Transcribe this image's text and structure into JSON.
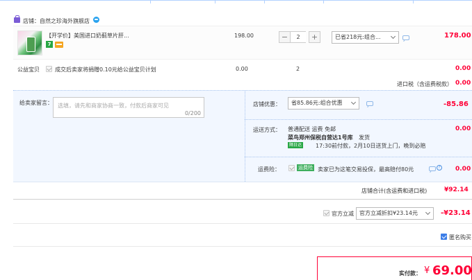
{
  "shop": {
    "label": "店铺：自然之珍海外旗舰店",
    "brand_color": "#7b5cd6",
    "chat_icon": "chat-bubble-icon"
  },
  "item": {
    "title": "【开学价】美国进口奶蓟草片肝...",
    "unit_price": "198.00",
    "quantity": "2",
    "promo_select": "已省218元:组合...",
    "subtotal": "178.00",
    "minus": "−",
    "plus": "+",
    "badge": "7"
  },
  "charity": {
    "label": "公益宝贝",
    "text": "成交后卖家将捐赠0.10元给公益宝贝计划",
    "price": "0.00",
    "qty": "2",
    "amount": "0.00"
  },
  "import_tax": {
    "label": "进口税（含运费税款）",
    "amount": "0.00"
  },
  "message": {
    "label": "给卖家留言：",
    "placeholder": "选填，请先和商家协商一致，付款后商家可见",
    "counter": "0/200"
  },
  "shop_discount": {
    "label": "店铺优惠：",
    "select": "省85.86元:组合优惠",
    "amount": "-85.86"
  },
  "shipping": {
    "label": "运送方式：",
    "method": "普通配送 运费 免邮",
    "warehouse": "菜鸟郑州保税自营达1号库",
    "ship_text": "发货",
    "tag": "隔日达",
    "eta": "17:30前付款，2月10日送货上门，晚到必赔",
    "amount": "0.00"
  },
  "insurance": {
    "label": "运费险：",
    "tag": "运费险",
    "text": "卖家已为这笔交易投保，最高赔付80元",
    "amount": "0.00"
  },
  "shop_total": {
    "label": "店铺合计(含运费和进口税)",
    "amount": "¥92.14"
  },
  "official_discount": {
    "label": "官方立减",
    "select": "官方立减折扣¥23.14元",
    "amount": "-¥23.14"
  },
  "anonymous": {
    "label": "匿名购买"
  },
  "payment": {
    "label": "实付款：",
    "currency": "¥",
    "amount": "69.00"
  },
  "colors": {
    "price_red": "#ff0036",
    "panel_bg": "#f2f7ff",
    "accent_blue": "#3c7ee8"
  }
}
